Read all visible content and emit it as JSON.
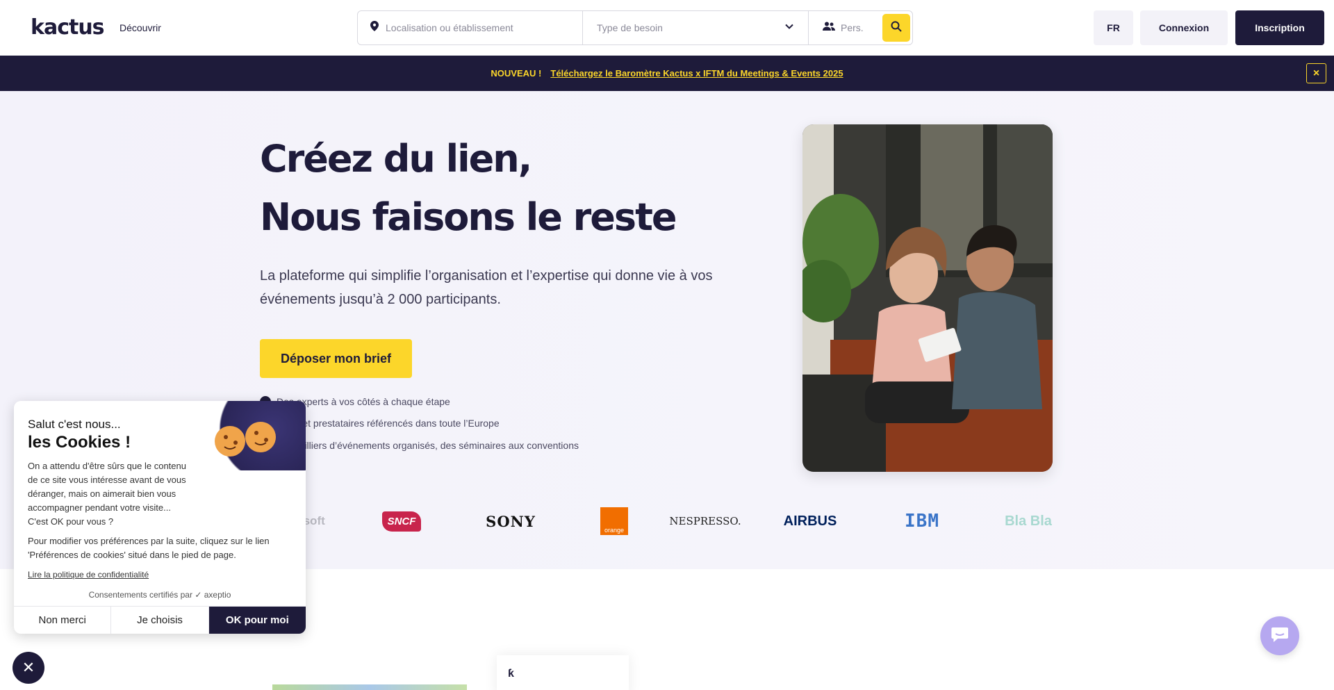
{
  "header": {
    "logo_text": "kactus",
    "nav_discover": "Découvrir",
    "search": {
      "location_placeholder": "Localisation ou établissement",
      "type_placeholder": "Type de besoin",
      "people_placeholder": "Pers."
    },
    "lang_label": "FR",
    "login_label": "Connexion",
    "signup_label": "Inscription"
  },
  "banner": {
    "new_label": "NOUVEAU !",
    "link_text": "Téléchargez le Baromètre Kactus x IFTM du Meetings & Events 2025",
    "close_symbol": "×"
  },
  "hero": {
    "title_line1": "Créez du lien,",
    "title_line2": "Nous faisons le reste",
    "subtitle": "La plateforme qui simplifie l’organisation et l’expertise qui donne vie à vos événements jusqu’à 2 000 participants.",
    "cta_label": "Déposer mon brief",
    "features": [
      "Des experts à vos côtés à chaque étape",
      "Lieux et prestataires référencés dans toute l’Europe",
      "Des milliers d’événements organisés, des séminaires aux conventions"
    ]
  },
  "logos": [
    "osoft",
    "SNCF",
    "SONY",
    "orange",
    "NESPRESSO.",
    "AIRBUS",
    "IBM",
    "Bla Bla"
  ],
  "cookie": {
    "greeting": "Salut c'est nous...",
    "title": "les Cookies !",
    "body_1": "On a attendu d'être sûrs que le contenu de ce site vous intéresse avant de vous déranger, mais on aimerait bien vous accompagner pendant votre visite...",
    "body_1b": "C'est OK pour vous ?",
    "body_2": "Pour modifier vos préférences par la suite, cliquez sur le lien 'Préférences de cookies' situé dans le pied de page.",
    "policy_link": "Lire la politique de confidentialité",
    "certified": "Consentements certifiés par",
    "certifier": "axeptio",
    "btn_no": "Non merci",
    "btn_choose": "Je choisis",
    "btn_ok": "OK pour moi"
  },
  "colors": {
    "navy": "#1e1b3a",
    "yellow": "#fcd62a",
    "hero_bg": "#f3f2fa",
    "chat": "#b6a8f0"
  },
  "icons": [
    "map-pin-icon",
    "chevron-down-icon",
    "people-icon",
    "search-icon",
    "close-icon",
    "check-icon",
    "chat-icon"
  ]
}
